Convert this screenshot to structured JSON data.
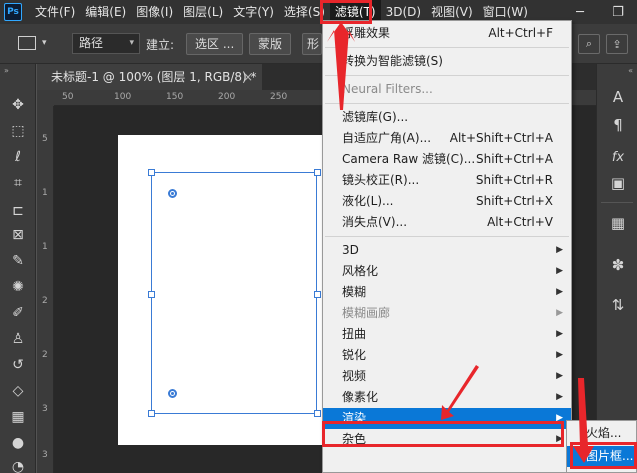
{
  "app": {
    "logo": "Ps"
  },
  "menubar": {
    "items": [
      "文件(F)",
      "编辑(E)",
      "图像(I)",
      "图层(L)",
      "文字(Y)",
      "选择(S)",
      "滤镜(T)",
      "3D(D)",
      "视图(V)",
      "窗口(W)"
    ],
    "active_index": 6,
    "window_controls": {
      "minimize": "─",
      "restore": "❐"
    }
  },
  "optionsbar": {
    "mode_select": "路径",
    "build_label": "建立:",
    "buttons": [
      "选区 ...",
      "蒙版",
      "形"
    ]
  },
  "document": {
    "tab_title": "未标题-1 @ 100% (图层 1, RGB/8) *",
    "close_glyph": "×"
  },
  "rulers": {
    "horizontal": [
      "50",
      "100",
      "150",
      "200",
      "250"
    ],
    "vertical": [
      "5",
      "1",
      "1",
      "2",
      "2",
      "3",
      "3"
    ]
  },
  "filter_menu": {
    "items": [
      {
        "label": "浮雕效果",
        "shortcut": "Alt+Ctrl+F"
      },
      {
        "label": "转换为智能滤镜(S)"
      },
      {
        "label": "Neural Filters...",
        "disabled": true
      },
      {
        "label": "滤镜库(G)..."
      },
      {
        "label": "自适应广角(A)...",
        "shortcut": "Alt+Shift+Ctrl+A"
      },
      {
        "label": "Camera Raw 滤镜(C)...",
        "shortcut": "Shift+Ctrl+A"
      },
      {
        "label": "镜头校正(R)...",
        "shortcut": "Shift+Ctrl+R"
      },
      {
        "label": "液化(L)...",
        "shortcut": "Shift+Ctrl+X"
      },
      {
        "label": "消失点(V)...",
        "shortcut": "Alt+Ctrl+V"
      },
      {
        "label": "3D",
        "submenu": true
      },
      {
        "label": "风格化",
        "submenu": true
      },
      {
        "label": "模糊",
        "submenu": true
      },
      {
        "label": "模糊画廊",
        "submenu": true,
        "disabled": true
      },
      {
        "label": "扭曲",
        "submenu": true
      },
      {
        "label": "锐化",
        "submenu": true
      },
      {
        "label": "视频",
        "submenu": true
      },
      {
        "label": "像素化",
        "submenu": true
      },
      {
        "label": "渲染",
        "submenu": true,
        "highlighted": true
      },
      {
        "label": "杂色",
        "submenu": true
      }
    ],
    "submenu_arrow": "▶"
  },
  "render_submenu": {
    "items": [
      {
        "label": "火焰..."
      },
      {
        "label": "图片框...",
        "highlighted": true
      }
    ]
  },
  "colors": {
    "accent_highlight": "#0a78d7",
    "annotation_red": "#e8262b",
    "path_blue": "#3a7bd5"
  },
  "icons": {
    "left_tools": [
      "move-icon",
      "marquee-icon",
      "lasso-icon",
      "quick-select-icon",
      "crop-icon",
      "frame-icon",
      "eyedropper-icon",
      "healing-brush-icon",
      "brush-icon",
      "clone-stamp-icon",
      "history-brush-icon",
      "eraser-icon",
      "gradient-icon",
      "blur-icon",
      "dodge-icon"
    ],
    "right_tools": [
      "character-icon",
      "paragraph-icon",
      "styles-icon",
      "libraries-icon",
      "swatches-icon",
      "color-icon",
      "paths-icon"
    ]
  }
}
